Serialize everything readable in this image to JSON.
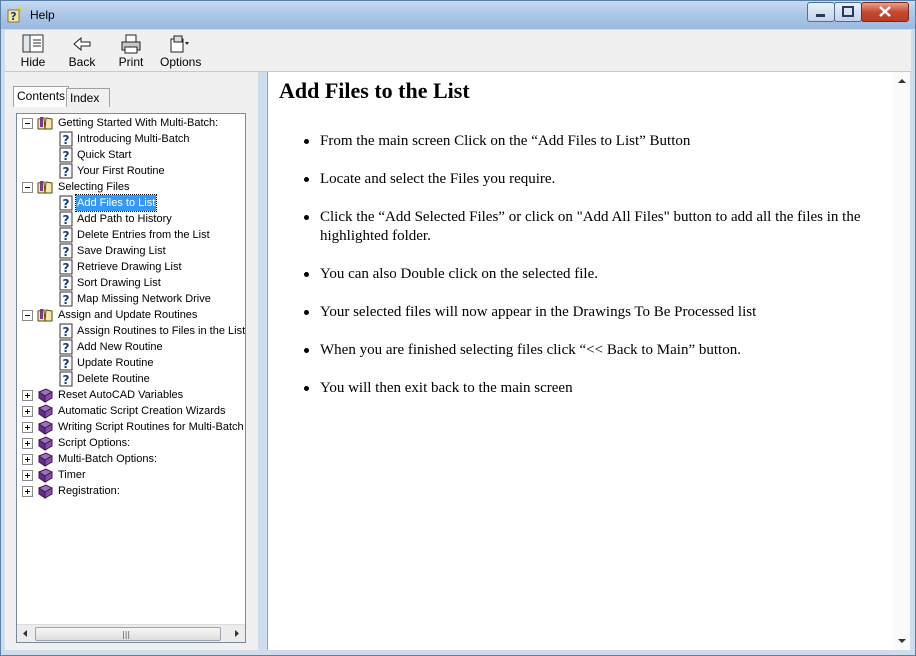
{
  "window": {
    "title": "Help"
  },
  "toolbar": {
    "hide_label": "Hide",
    "back_label": "Back",
    "print_label": "Print",
    "options_label": "Options"
  },
  "tabs": {
    "contents": "Contents",
    "index": "Index"
  },
  "tree": [
    {
      "label": "Getting Started With Multi-Batch:",
      "type": "book-open",
      "expanded": true,
      "children": [
        "Introducing Multi-Batch",
        "Quick Start",
        "Your First Routine"
      ]
    },
    {
      "label": "Selecting Files",
      "type": "book-open",
      "expanded": true,
      "children": [
        "Add Files to List",
        "Add Path to History",
        "Delete Entries from the List",
        "Save Drawing List",
        "Retrieve Drawing List",
        "Sort Drawing List",
        "Map Missing Network Drive"
      ]
    },
    {
      "label": "Assign and Update Routines",
      "type": "book-open",
      "expanded": true,
      "children": [
        "Assign Routines to Files in the List",
        "Add New Routine",
        "Update Routine",
        "Delete Routine"
      ]
    },
    {
      "label": "Reset AutoCAD Variables",
      "type": "book-closed",
      "expanded": false,
      "children": []
    },
    {
      "label": "Automatic Script Creation Wizards",
      "type": "book-closed",
      "expanded": false,
      "children": []
    },
    {
      "label": "Writing Script Routines for Multi-Batch",
      "type": "book-closed",
      "expanded": false,
      "children": []
    },
    {
      "label": "Script Options:",
      "type": "book-closed",
      "expanded": false,
      "children": []
    },
    {
      "label": "Multi-Batch Options:",
      "type": "book-closed",
      "expanded": false,
      "children": []
    },
    {
      "label": "Timer",
      "type": "book-closed",
      "expanded": false,
      "children": []
    },
    {
      "label": "Registration:",
      "type": "book-closed",
      "expanded": false,
      "children": []
    }
  ],
  "selected_topic": "Add Files to List",
  "content": {
    "heading": "Add Files to the List",
    "bullets": [
      "From the main screen Click on the “Add Files to List” Button",
      "Locate and select the Files you require.",
      "Click the “Add Selected Files” or click on \"Add All Files\" button to add all the files in the highlighted folder.",
      "You can also Double click on the selected file.",
      "Your selected files will now appear in the Drawings To Be Processed list",
      "When you are finished selecting files click “<< Back to Main” button.",
      "You will then exit back to the main screen"
    ]
  },
  "colors": {
    "selection": "#3399ff",
    "titlebar": "#b3cae8",
    "close_button": "#c44a30"
  }
}
